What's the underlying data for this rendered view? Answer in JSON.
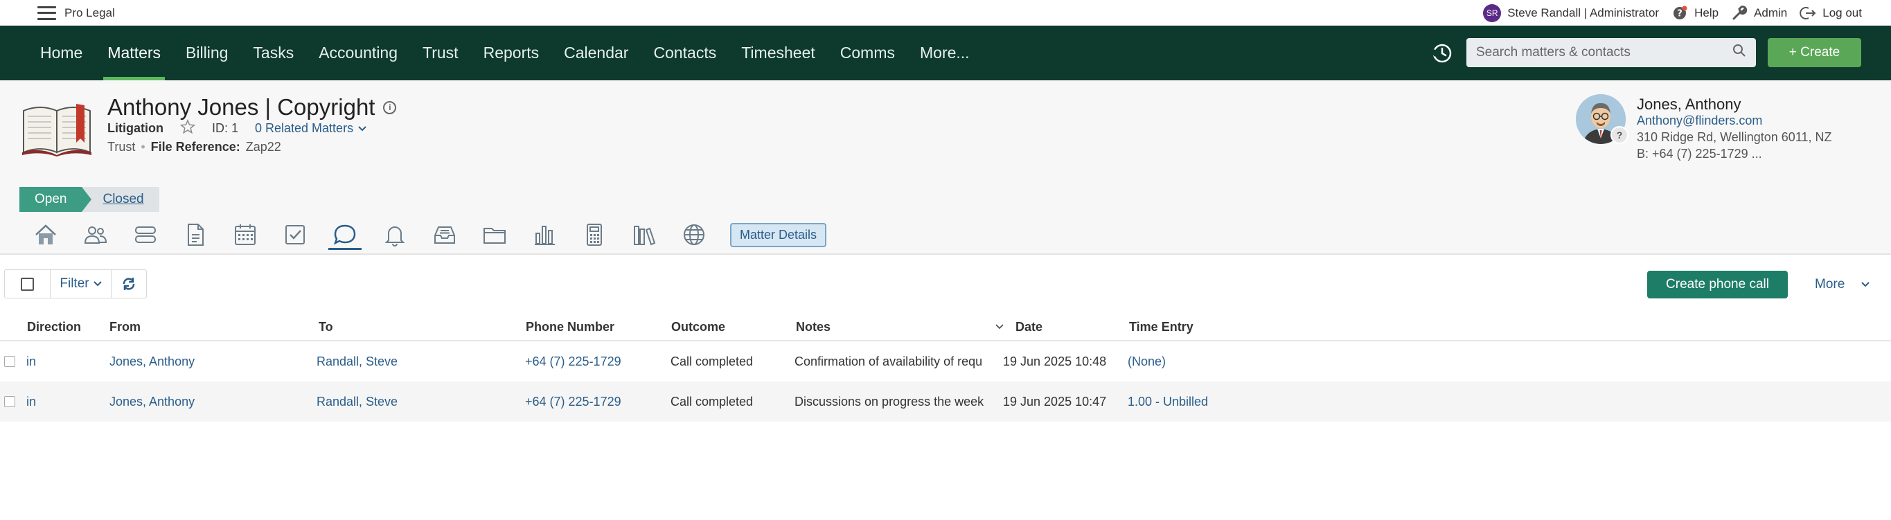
{
  "app": {
    "name": "Pro Legal"
  },
  "user": {
    "initials": "SR",
    "label": "Steve Randall | Administrator"
  },
  "utility": {
    "help": "Help",
    "admin": "Admin",
    "logout": "Log out"
  },
  "nav": {
    "items": [
      "Home",
      "Matters",
      "Billing",
      "Tasks",
      "Accounting",
      "Trust",
      "Reports",
      "Calendar",
      "Contacts",
      "Timesheet",
      "Comms",
      "More..."
    ],
    "active": "Matters",
    "search_placeholder": "Search matters & contacts",
    "create_label": "+ Create"
  },
  "matter": {
    "title": "Anthony Jones | Copyright",
    "type": "Litigation",
    "id_label": "ID: 1",
    "related": "0 Related Matters",
    "trust": "Trust",
    "file_ref_label": "File Reference:",
    "file_ref": "Zap22"
  },
  "contact": {
    "name": "Jones, Anthony",
    "email": "Anthony@flinders.com",
    "address": "310 Ridge Rd, Wellington 6011, NZ",
    "phone": "B: +64 (7) 225-1729 ..."
  },
  "status": {
    "open": "Open",
    "closed": "Closed"
  },
  "tabs": {
    "icons": [
      "home-icon",
      "people-icon",
      "stack-icon",
      "document-icon",
      "calendar-icon",
      "checkbox-icon",
      "chat-icon",
      "bell-icon",
      "inbox-icon",
      "folder-icon",
      "bar-chart-icon",
      "calculator-icon",
      "books-icon",
      "globe-icon"
    ],
    "active": "chat-icon",
    "matter_details": "Matter Details"
  },
  "toolbar": {
    "filter": "Filter",
    "create_phone_call": "Create phone call",
    "more": "More"
  },
  "table": {
    "headers": {
      "direction": "Direction",
      "from": "From",
      "to": "To",
      "phone": "Phone Number",
      "outcome": "Outcome",
      "notes": "Notes",
      "date": "Date",
      "time_entry": "Time Entry"
    },
    "rows": [
      {
        "direction": "in",
        "from": "Jones, Anthony",
        "to": "Randall, Steve",
        "phone": "+64 (7) 225-1729",
        "outcome": "Call completed",
        "notes": "Confirmation of availability of requ",
        "date": "19 Jun 2025 10:48",
        "time_entry": "(None)"
      },
      {
        "direction": "in",
        "from": "Jones, Anthony",
        "to": "Randall, Steve",
        "phone": "+64 (7) 225-1729",
        "outcome": "Call completed",
        "notes": "Discussions on progress the week",
        "date": "19 Jun 2025 10:47",
        "time_entry": "1.00 - Unbilled"
      }
    ]
  },
  "colors": {
    "nav_bg": "#0d3a2c",
    "accent_green": "#5aa857",
    "primary_button": "#1d7d66",
    "link": "#2a5d8a",
    "open_status": "#3d9c84"
  }
}
